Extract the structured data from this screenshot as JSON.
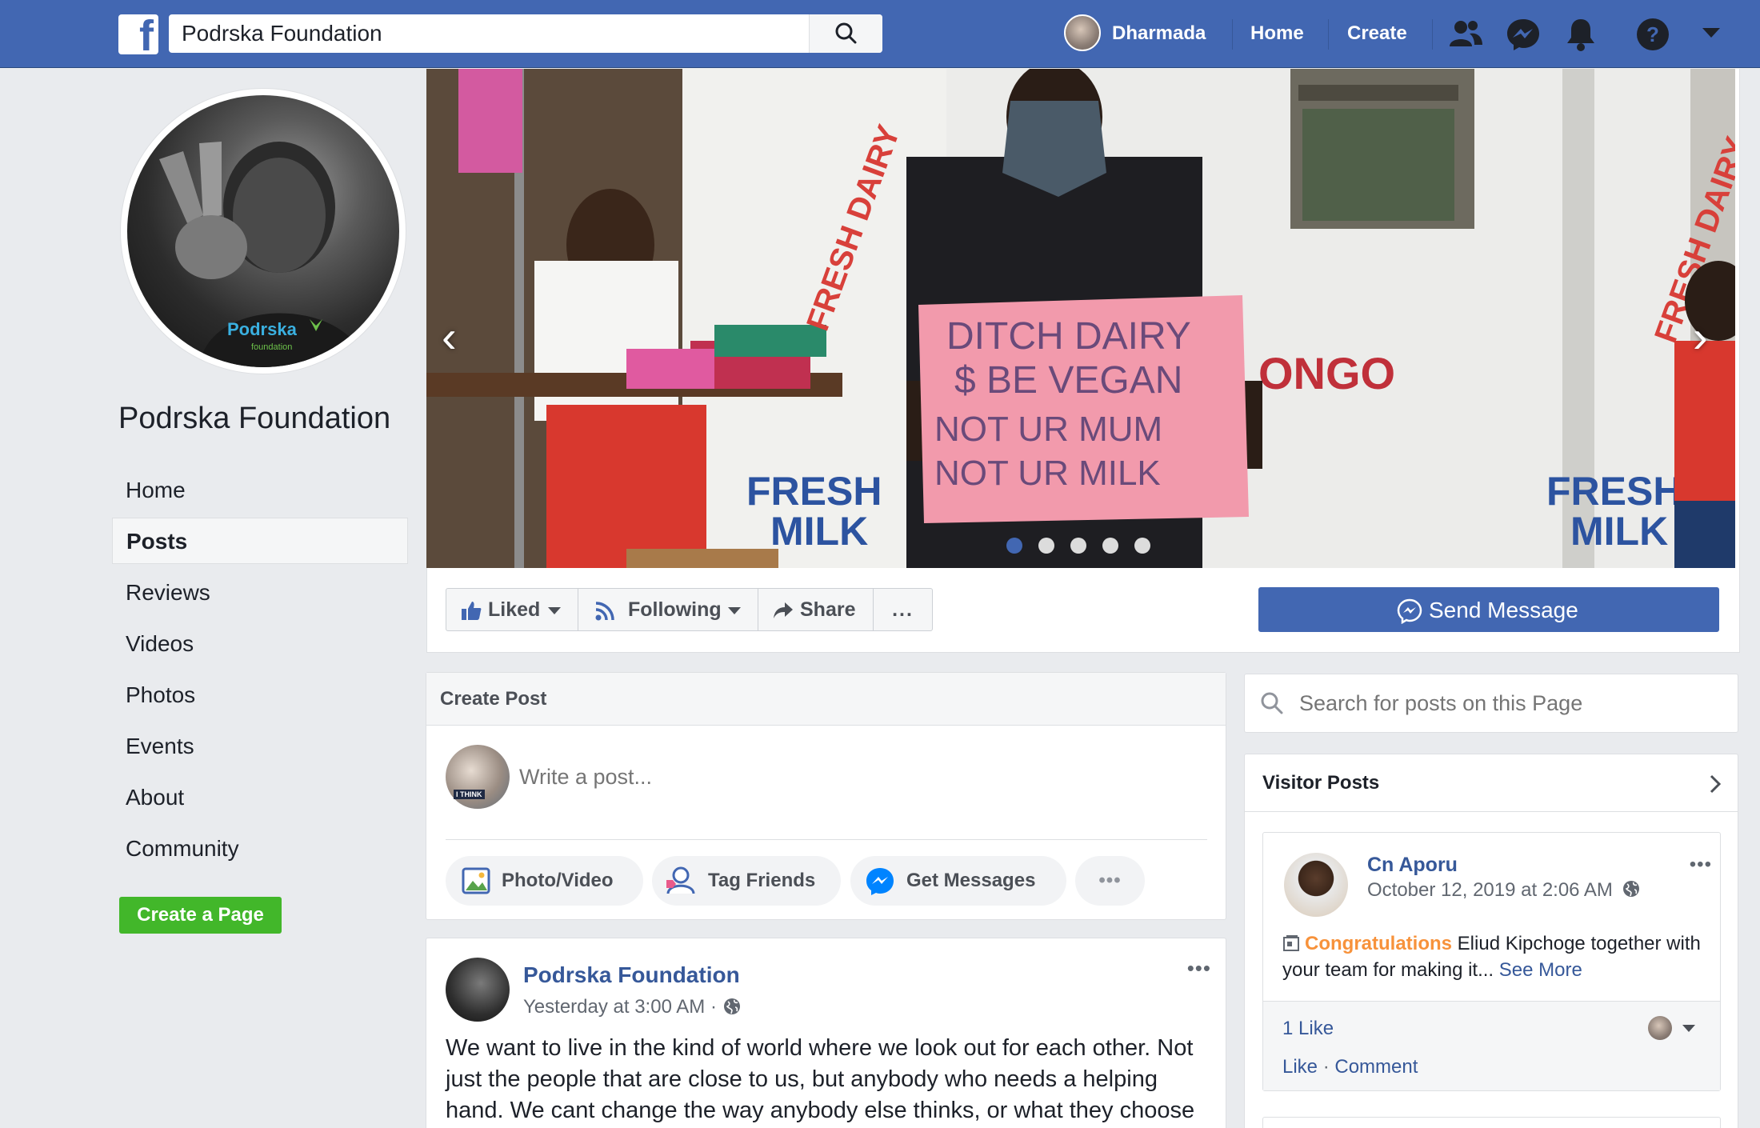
{
  "topbar": {
    "search_value": "Podrska Foundation",
    "user_name": "Dharmada",
    "home_label": "Home",
    "create_label": "Create"
  },
  "page": {
    "name": "Podrska Foundation",
    "logo_text": "Podrska",
    "logo_sub": "foundation",
    "nav": [
      {
        "label": "Home"
      },
      {
        "label": "Posts"
      },
      {
        "label": "Reviews"
      },
      {
        "label": "Videos"
      },
      {
        "label": "Photos"
      },
      {
        "label": "Events"
      },
      {
        "label": "About"
      },
      {
        "label": "Community"
      }
    ],
    "active_nav": "Posts",
    "create_page_label": "Create a Page"
  },
  "cover": {
    "sign_lines": [
      "DITCH DAIRY",
      "$ BE VEGAN",
      "NOT UR MUM",
      "NOT UR MILK"
    ],
    "shop_text_1": "FRESH DAIRY",
    "shop_text_2": "FRESH",
    "shop_text_3": "MILK",
    "shop_text_4": "ONGO",
    "slide_count": 5,
    "active_slide": 1
  },
  "actions": {
    "liked": "Liked",
    "following": "Following",
    "share": "Share",
    "more": "...",
    "send_message": "Send Message"
  },
  "create_post": {
    "title": "Create Post",
    "placeholder": "Write a post...",
    "photo_video": "Photo/Video",
    "tag_friends": "Tag Friends",
    "get_messages": "Get Messages",
    "more": "•••",
    "avatar_caption": "I THINK"
  },
  "post": {
    "author": "Podrska Foundation",
    "time": "Yesterday at 3:00 AM",
    "separator": "·",
    "more": "•••",
    "text": "We want to live in the kind of world where we look out for each other. Not just the people that are close to us, but anybody who needs a helping hand. We cant change the way anybody else thinks, or what they choose"
  },
  "sidebar": {
    "search_placeholder": "Search for posts on this Page",
    "visitor_posts_title": "Visitor Posts",
    "visitor_post": {
      "author": "Cn Aporu",
      "time": "October 12, 2019 at 2:06 AM",
      "more": "•••",
      "highlight": "Congratulations",
      "text": " Eliud Kipchoge together with your team for making it...",
      "see_more": "See More",
      "likes": "1 Like",
      "like": "Like",
      "dot": " · ",
      "comment": "Comment"
    }
  },
  "colors": {
    "brand": "#4267b2",
    "link": "#365899",
    "green": "#42b72a",
    "highlight": "#f7923b"
  }
}
